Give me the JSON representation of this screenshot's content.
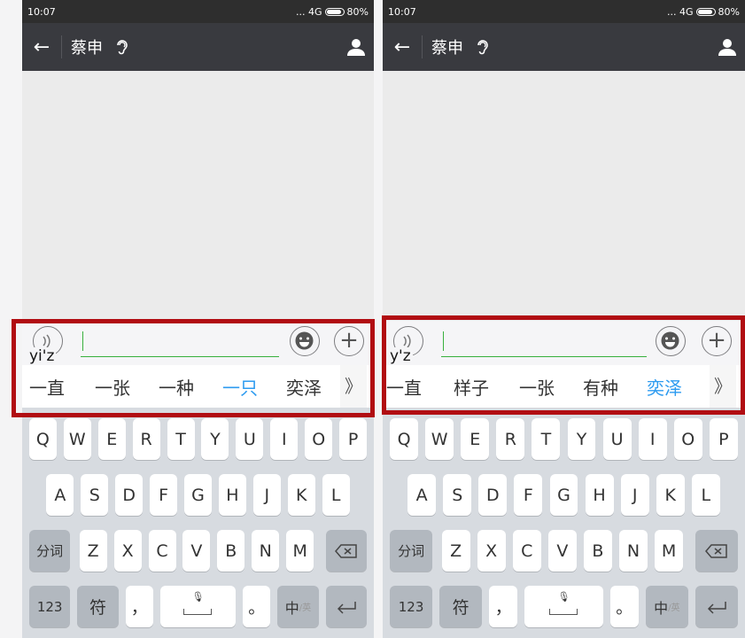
{
  "panels": [
    {
      "status": {
        "time": "10:07",
        "signal": "... 4G",
        "battery": "80%"
      },
      "chat": {
        "title": "蔡申"
      },
      "input": {
        "pinyin": "yi'z"
      },
      "candidates": [
        {
          "text": "一直",
          "selected": false
        },
        {
          "text": "一张",
          "selected": false
        },
        {
          "text": "一种",
          "selected": false
        },
        {
          "text": "一只",
          "selected": true
        },
        {
          "text": "奕泽",
          "selected": false
        }
      ],
      "more_label": "》"
    },
    {
      "status": {
        "time": "10:07",
        "signal": "... 4G",
        "battery": "80%"
      },
      "chat": {
        "title": "蔡申"
      },
      "input": {
        "pinyin": "y'z"
      },
      "candidates": [
        {
          "text": "一直",
          "selected": false
        },
        {
          "text": "样子",
          "selected": false
        },
        {
          "text": "一张",
          "selected": false
        },
        {
          "text": "有种",
          "selected": false
        },
        {
          "text": "奕泽",
          "selected": true
        }
      ],
      "more_label": "》"
    }
  ],
  "keyboard": {
    "row1": [
      "Q",
      "W",
      "E",
      "R",
      "T",
      "Y",
      "U",
      "I",
      "O",
      "P"
    ],
    "row2": [
      "A",
      "S",
      "D",
      "F",
      "G",
      "H",
      "J",
      "K",
      "L"
    ],
    "row3": [
      "Z",
      "X",
      "C",
      "V",
      "B",
      "N",
      "M"
    ],
    "fenci": "分词",
    "num": "123",
    "fu": "符",
    "comma": "，",
    "period": "。",
    "zh": "中",
    "en": "/英"
  },
  "colors": {
    "selected_candidate": "#2d9bf0",
    "highlight_box": "#b10d12",
    "input_underline": "#38b03d",
    "appbar": "#393a3f"
  },
  "icons": [
    "back-arrow-icon",
    "ear-icon",
    "person-icon",
    "voice-icon",
    "emoji-icon",
    "plus-icon",
    "backspace-icon",
    "mic-icon",
    "enter-icon"
  ]
}
